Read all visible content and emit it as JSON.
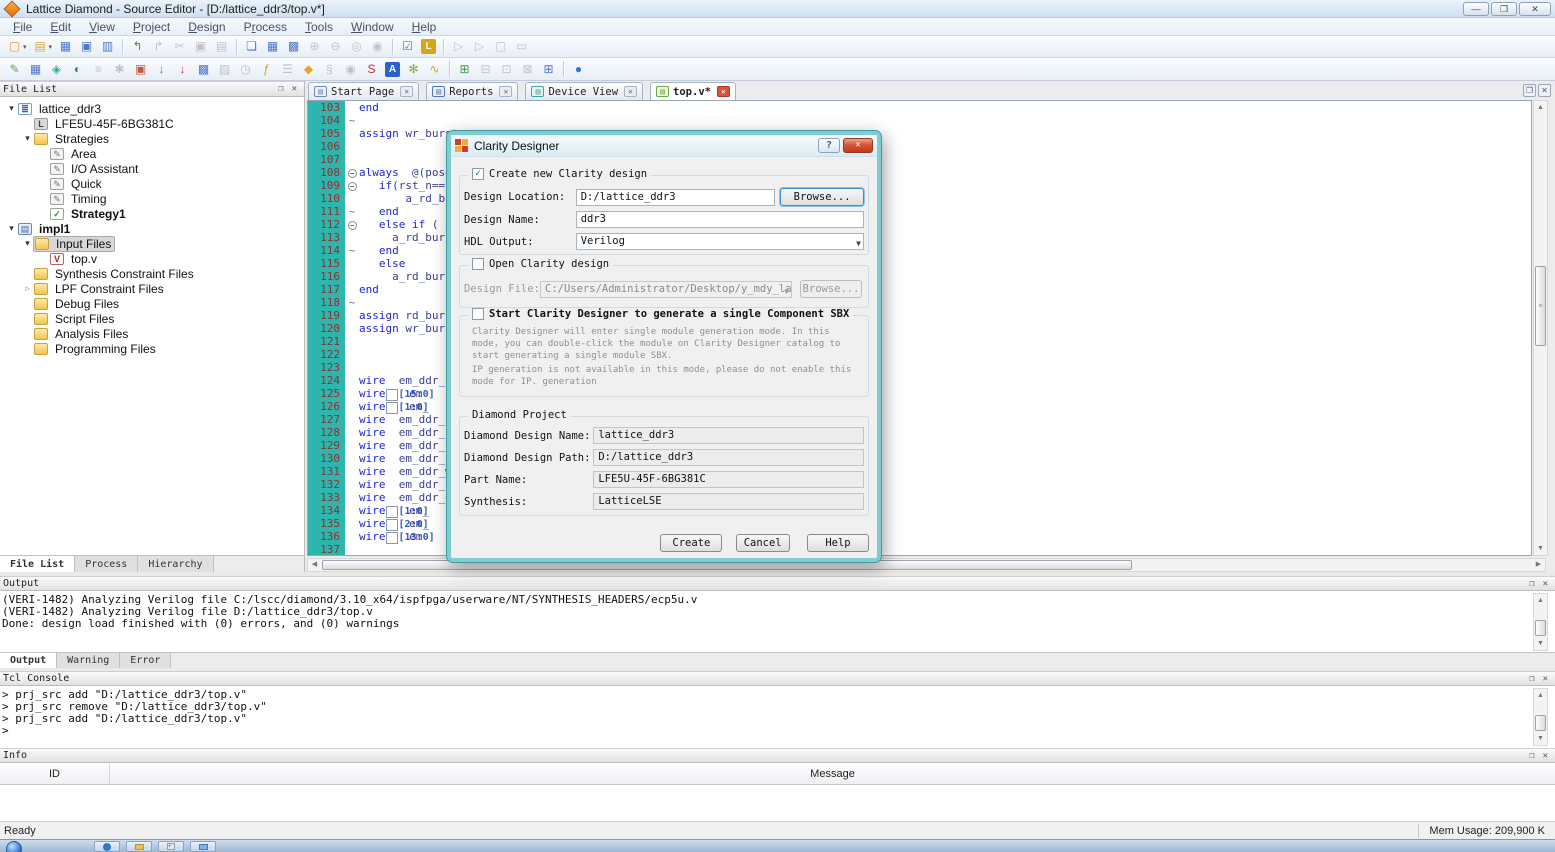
{
  "window": {
    "title": "Lattice Diamond - Source Editor - [D:/lattice_ddr3/top.v*]"
  },
  "menu": {
    "items": [
      {
        "label": "File",
        "u": 0
      },
      {
        "label": "Edit",
        "u": 0
      },
      {
        "label": "View",
        "u": 0
      },
      {
        "label": "Project",
        "u": 0
      },
      {
        "label": "Design",
        "u": 0
      },
      {
        "label": "Process",
        "u": 1
      },
      {
        "label": "Tools",
        "u": 0
      },
      {
        "label": "Window",
        "u": 0
      },
      {
        "label": "Help",
        "u": 0
      }
    ]
  },
  "toolbar1": [
    {
      "name": "new-file",
      "g": "▢",
      "c": "#e8962e",
      "dd": true
    },
    {
      "name": "open-file",
      "g": "▤",
      "c": "#e0a83c",
      "dd": true
    },
    {
      "name": "save",
      "g": "▦",
      "c": "#4a77c9"
    },
    {
      "name": "save-all",
      "g": "▣",
      "c": "#4a77c9"
    },
    {
      "name": "print",
      "g": "▥",
      "c": "#4a77c9"
    },
    {
      "sep": true
    },
    {
      "name": "import-source",
      "g": "↰",
      "c": "#3a9c3a"
    },
    {
      "name": "export-source",
      "g": "↱",
      "c": "#9a9a9a",
      "dim": true
    },
    {
      "name": "cut",
      "g": "✂",
      "c": "#9a9a9a",
      "dim": true
    },
    {
      "name": "copy",
      "g": "▣",
      "c": "#9a9a9a",
      "dim": true
    },
    {
      "name": "paste",
      "g": "▤",
      "c": "#9a9a9a",
      "dim": true
    },
    {
      "sep": true
    },
    {
      "name": "find-text",
      "g": "❏",
      "c": "#4a77c9"
    },
    {
      "name": "spreadsheet-view",
      "g": "▦",
      "c": "#4a77c9"
    },
    {
      "name": "find-in-files",
      "g": "▩",
      "c": "#4a77c9"
    },
    {
      "name": "zoom-in",
      "g": "⊕",
      "c": "#9a9a9a",
      "dim": true
    },
    {
      "name": "zoom-out",
      "g": "⊖",
      "c": "#9a9a9a",
      "dim": true
    },
    {
      "name": "zoom-area",
      "g": "◎",
      "c": "#9a9a9a",
      "dim": true
    },
    {
      "name": "zoom-fit",
      "g": "◉",
      "c": "#9a9a9a",
      "dim": true
    },
    {
      "sep": true
    },
    {
      "name": "run-manager",
      "g": "☑",
      "c": "#3f9c4f"
    },
    {
      "name": "logic-block",
      "g": "L",
      "c": "#fff",
      "bg": "#d8a516"
    },
    {
      "sep": true
    },
    {
      "name": "run-all",
      "g": "▷",
      "c": "#9a9a9a",
      "dim": true
    },
    {
      "name": "rerun",
      "g": "▷",
      "c": "#9a9a9a",
      "dim": true
    },
    {
      "name": "rerun-from",
      "g": "▢",
      "c": "#9a9a9a",
      "dim": true
    },
    {
      "name": "stop-process",
      "g": "▭",
      "c": "#9a9a9a",
      "dim": true
    }
  ],
  "toolbar2": [
    {
      "name": "pencil-edit",
      "g": "✎",
      "c": "#6aa83c"
    },
    {
      "name": "report-grid",
      "g": "▦",
      "c": "#4a77c9"
    },
    {
      "name": "device-chip",
      "g": "◈",
      "c": "#3aa7a0"
    },
    {
      "name": "device-search",
      "g": "◐",
      "c": "#2e8b57"
    },
    {
      "name": "hierarchy-list",
      "g": "≡",
      "c": "#9a9a9a",
      "dim": true
    },
    {
      "name": "gear",
      "g": "✱",
      "c": "#9a9a9a",
      "dim": true
    },
    {
      "name": "floorplan",
      "g": "▣",
      "c": "#c05a3a"
    },
    {
      "name": "download-green",
      "g": "↓",
      "c": "#3a9c3a"
    },
    {
      "name": "download-red",
      "g": "↓",
      "c": "#c03a3a"
    },
    {
      "name": "package-view",
      "g": "▩",
      "c": "#4a77c9"
    },
    {
      "name": "netlist-view",
      "g": "▨",
      "c": "#9a9a9a",
      "dim": true
    },
    {
      "name": "clock-timing",
      "g": "◷",
      "c": "#9a9a9a",
      "dim": true
    },
    {
      "name": "power-calculator",
      "g": "ƒ",
      "c": "#d8a516"
    },
    {
      "name": "layer-stack",
      "g": "☰",
      "c": "#9a9a9a",
      "dim": true
    },
    {
      "name": "shield-gold",
      "g": "◆",
      "c": "#e8a32e"
    },
    {
      "name": "script-s",
      "g": "§",
      "c": "#9a9a9a",
      "dim": true
    },
    {
      "name": "search-round",
      "g": "◉",
      "c": "#9a9a9a",
      "dim": true
    },
    {
      "name": "sync-red",
      "g": "S",
      "c": "#c03030"
    },
    {
      "name": "analysis-a",
      "g": "A",
      "c": "#fff",
      "bg": "#2a62c8"
    },
    {
      "name": "flower-tool",
      "g": "✻",
      "c": "#8aa83c"
    },
    {
      "name": "lightning",
      "g": "∿",
      "c": "#d8a516"
    },
    {
      "sep": true
    },
    {
      "name": "window-add",
      "g": "⊞",
      "c": "#3f9c4f"
    },
    {
      "name": "window-left",
      "g": "⊟",
      "c": "#9a9a9a",
      "dim": true
    },
    {
      "name": "window-right",
      "g": "⊡",
      "c": "#9a9a9a",
      "dim": true
    },
    {
      "name": "window-bottom",
      "g": "⊠",
      "c": "#9a9a9a",
      "dim": true
    },
    {
      "name": "window-grid",
      "g": "⊞",
      "c": "#4a77c9"
    },
    {
      "sep": true
    },
    {
      "name": "web-globe",
      "g": "●",
      "c": "#3a77c9"
    }
  ],
  "file_list": {
    "title": "File List",
    "tabs": [
      {
        "label": "File List",
        "active": true
      },
      {
        "label": "Process"
      },
      {
        "label": "Hierarchy"
      }
    ],
    "tree": [
      {
        "lvl": 0,
        "exp": "open",
        "icon": "project",
        "glyph": "≣",
        "label": "lattice_ddr3"
      },
      {
        "lvl": 1,
        "exp": "none",
        "icon": "device",
        "glyph": "L",
        "label": "LFE5U-45F-6BG381C"
      },
      {
        "lvl": 1,
        "exp": "open",
        "icon": "folder",
        "glyph": "",
        "label": "Strategies"
      },
      {
        "lvl": 2,
        "exp": "none",
        "icon": "strategy",
        "glyph": "✎",
        "label": "Area"
      },
      {
        "lvl": 2,
        "exp": "none",
        "icon": "strategy",
        "glyph": "✎",
        "label": "I/O Assistant"
      },
      {
        "lvl": 2,
        "exp": "none",
        "icon": "strategy",
        "glyph": "✎",
        "label": "Quick"
      },
      {
        "lvl": 2,
        "exp": "none",
        "icon": "strategy",
        "glyph": "✎",
        "label": "Timing"
      },
      {
        "lvl": 2,
        "exp": "none",
        "icon": "strategy-check",
        "glyph": "✓",
        "label": "Strategy1",
        "bold": true
      },
      {
        "lvl": 0,
        "exp": "open",
        "icon": "impl",
        "glyph": "▤",
        "label": "impl1",
        "bold": true
      },
      {
        "lvl": 1,
        "exp": "open",
        "icon": "folder",
        "glyph": "",
        "label": "Input Files",
        "selected": true
      },
      {
        "lvl": 2,
        "exp": "none",
        "icon": "verilog",
        "glyph": "V",
        "label": "top.v"
      },
      {
        "lvl": 1,
        "exp": "none",
        "icon": "folder",
        "glyph": "",
        "label": "Synthesis Constraint Files"
      },
      {
        "lvl": 1,
        "exp": "closed",
        "icon": "folder",
        "glyph": "",
        "label": "LPF Constraint Files"
      },
      {
        "lvl": 1,
        "exp": "none",
        "icon": "folder",
        "glyph": "",
        "label": "Debug Files"
      },
      {
        "lvl": 1,
        "exp": "none",
        "icon": "folder",
        "glyph": "",
        "label": "Script Files"
      },
      {
        "lvl": 1,
        "exp": "none",
        "icon": "folder",
        "glyph": "",
        "label": "Analysis Files"
      },
      {
        "lvl": 1,
        "exp": "none",
        "icon": "folder",
        "glyph": "",
        "label": "Programming Files"
      }
    ]
  },
  "editor": {
    "tabs": [
      {
        "label": "Start Page",
        "icon": "page",
        "ic": "#6a87b8",
        "bg": "#eef2f8"
      },
      {
        "label": "Reports",
        "icon": "report",
        "ic": "#4a77c9",
        "bg": "#eef2f8"
      },
      {
        "label": "Device View",
        "icon": "device",
        "ic": "#3aa7a0",
        "bg": "#e8f4f3"
      },
      {
        "label": "top.v*",
        "icon": "edit",
        "ic": "#6aa83c",
        "bg": "#f2f6ee",
        "active": true
      }
    ],
    "lines": [
      {
        "n": 103,
        "f": "",
        "s": [
          [
            "k",
            "end"
          ]
        ]
      },
      {
        "n": 104,
        "f": "t",
        "s": []
      },
      {
        "n": 105,
        "f": "",
        "s": [
          [
            "k",
            "assign"
          ],
          [
            "i",
            " wr_burst"
          ]
        ]
      },
      {
        "n": 106,
        "f": "",
        "s": []
      },
      {
        "n": 107,
        "f": "",
        "s": []
      },
      {
        "n": 108,
        "f": "m",
        "s": [
          [
            "k",
            "always"
          ],
          [
            "i",
            "  @(posed"
          ]
        ]
      },
      {
        "n": 109,
        "f": "m",
        "s": [
          [
            "i",
            "   "
          ],
          [
            "k",
            "if"
          ],
          [
            "i",
            "(rst_n==1"
          ]
        ]
      },
      {
        "n": 110,
        "f": "",
        "s": [
          [
            "i",
            "       a_rd_bur"
          ]
        ]
      },
      {
        "n": 111,
        "f": "t",
        "s": [
          [
            "i",
            "   "
          ],
          [
            "k",
            "end"
          ]
        ]
      },
      {
        "n": 112,
        "f": "m",
        "s": [
          [
            "i",
            "   "
          ],
          [
            "k",
            "else"
          ],
          [
            "i",
            " "
          ],
          [
            "k",
            "if"
          ],
          [
            "i",
            " ( a"
          ]
        ]
      },
      {
        "n": 113,
        "f": "",
        "s": [
          [
            "i",
            "     a_rd_burs"
          ]
        ]
      },
      {
        "n": 114,
        "f": "t",
        "s": [
          [
            "i",
            "   "
          ],
          [
            "k",
            "end"
          ]
        ]
      },
      {
        "n": 115,
        "f": "",
        "s": [
          [
            "i",
            "   "
          ],
          [
            "k",
            "else"
          ]
        ]
      },
      {
        "n": 116,
        "f": "",
        "s": [
          [
            "i",
            "     a_rd_burs"
          ]
        ]
      },
      {
        "n": 117,
        "f": "",
        "s": [
          [
            "k",
            "end"
          ]
        ]
      },
      {
        "n": 118,
        "f": "t",
        "s": []
      },
      {
        "n": 119,
        "f": "",
        "s": [
          [
            "k",
            "assign"
          ],
          [
            "i",
            " rd_burst"
          ]
        ]
      },
      {
        "n": 120,
        "f": "",
        "s": [
          [
            "k",
            "assign"
          ],
          [
            "i",
            " wr_burst"
          ]
        ]
      },
      {
        "n": 121,
        "f": "",
        "s": []
      },
      {
        "n": 122,
        "f": "",
        "s": []
      },
      {
        "n": 123,
        "f": "",
        "s": []
      },
      {
        "n": 124,
        "f": "",
        "s": [
          [
            "k",
            "wire"
          ],
          [
            "i",
            "  em_ddr_re"
          ]
        ]
      },
      {
        "n": 125,
        "f": "",
        "s": [
          [
            "k",
            "wire"
          ],
          [
            "b",
            "  [15:0]"
          ],
          [
            "i",
            " em"
          ]
        ]
      },
      {
        "n": 126,
        "f": "",
        "s": [
          [
            "k",
            "wire"
          ],
          [
            "b",
            "  [1:0]"
          ],
          [
            "i",
            " em_"
          ]
        ]
      },
      {
        "n": 127,
        "f": "",
        "s": [
          [
            "k",
            "wire"
          ],
          [
            "i",
            "  em_ddr_cl"
          ]
        ]
      },
      {
        "n": 128,
        "f": "",
        "s": [
          [
            "k",
            "wire"
          ],
          [
            "i",
            "  em_ddr_ck"
          ]
        ]
      },
      {
        "n": 129,
        "f": "",
        "s": [
          [
            "k",
            "wire"
          ],
          [
            "i",
            "  em_ddr_ra"
          ]
        ]
      },
      {
        "n": 130,
        "f": "",
        "s": [
          [
            "k",
            "wire"
          ],
          [
            "i",
            "  em_ddr_ca"
          ]
        ]
      },
      {
        "n": 131,
        "f": "",
        "s": [
          [
            "k",
            "wire"
          ],
          [
            "i",
            "  em_ddr_we"
          ]
        ]
      },
      {
        "n": 132,
        "f": "",
        "s": [
          [
            "k",
            "wire"
          ],
          [
            "i",
            "  em_ddr_cs"
          ]
        ]
      },
      {
        "n": 133,
        "f": "",
        "s": [
          [
            "k",
            "wire"
          ],
          [
            "i",
            "  em_ddr_od"
          ]
        ]
      },
      {
        "n": 134,
        "f": "",
        "s": [
          [
            "k",
            "wire"
          ],
          [
            "b",
            "  [1:0]"
          ],
          [
            "i",
            " em_"
          ]
        ]
      },
      {
        "n": 135,
        "f": "",
        "s": [
          [
            "k",
            "wire"
          ],
          [
            "b",
            "  [2:0]"
          ],
          [
            "i",
            " em_"
          ]
        ]
      },
      {
        "n": 136,
        "f": "",
        "s": [
          [
            "k",
            "wire"
          ],
          [
            "b",
            "  [13:0]"
          ],
          [
            "i",
            " em"
          ]
        ]
      },
      {
        "n": 137,
        "f": "",
        "s": []
      }
    ]
  },
  "dialog": {
    "title": "Clarity Designer",
    "create_group": {
      "label": "Create new Clarity design",
      "design_location_label": "Design Location:",
      "design_location": "D:/lattice_ddr3",
      "browse_label": "Browse...",
      "design_name_label": "Design Name:",
      "design_name": "ddr3",
      "hdl_output_label": "HDL Output:",
      "hdl_output": "Verilog"
    },
    "open_group": {
      "label": "Open Clarity design",
      "design_file_label": "Design File:",
      "design_file": "C:/Users/Administrator/Desktop/y_mdy_lattice_lvds",
      "browse_label": "Browse..."
    },
    "sbx_group": {
      "label": "Start Clarity Designer to generate a single Component SBX",
      "desc1": "Clarity Designer will enter single module generation mode. In this mode, you can double-click the module on Clarity Designer catalog to start generating a single module SBX.",
      "desc2": "IP generation is not available in this mode, please do not enable this mode for IP. generation"
    },
    "project_group": {
      "label": "Diamond Project",
      "rows": [
        [
          "Diamond Design Name:",
          "lattice_ddr3"
        ],
        [
          "Diamond Design Path:",
          "D:/lattice_ddr3"
        ],
        [
          "Part Name:",
          "LFE5U-45F-6BG381C"
        ],
        [
          "Synthesis:",
          "LatticeLSE"
        ]
      ]
    },
    "buttons": {
      "create": "Create",
      "cancel": "Cancel",
      "help": "Help"
    }
  },
  "output": {
    "title": "Output",
    "lines": [
      "(VERI-1482) Analyzing Verilog file C:/lscc/diamond/3.10_x64/ispfpga/userware/NT/SYNTHESIS_HEADERS/ecp5u.v",
      "(VERI-1482) Analyzing Verilog file D:/lattice_ddr3/top.v",
      "Done: design load finished with (0) errors, and (0) warnings"
    ],
    "tabs": [
      {
        "label": "Output",
        "active": true
      },
      {
        "label": "Warning"
      },
      {
        "label": "Error"
      }
    ]
  },
  "tcl": {
    "title": "Tcl Console",
    "lines": [
      "> prj_src add \"D:/lattice_ddr3/top.v\"",
      "> prj_src remove \"D:/lattice_ddr3/top.v\"",
      "> prj_src add \"D:/lattice_ddr3/top.v\"",
      ">"
    ]
  },
  "info": {
    "title": "Info",
    "columns": {
      "id": "ID",
      "message": "Message"
    }
  },
  "status": {
    "ready": "Ready",
    "mem": "Mem Usage:  209,900 K"
  }
}
